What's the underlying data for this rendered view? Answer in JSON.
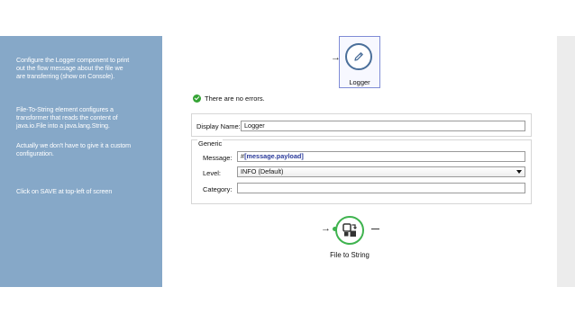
{
  "instructions": {
    "note_1": "Configure the Logger component to print\nout the flow message about the file we\nare transferring (show on Console).",
    "note_2": "File-To-String element configures a\ntransformer that reads the content of\njava.io.File into a java.lang.String.",
    "note_3": "Actually we don't have to give it a custom\nconfiguration.",
    "note_4": "Click on SAVE at top-left of screen"
  },
  "flow": {
    "arrow_glyph": "→",
    "logger_node": {
      "label": "Logger",
      "icon": "pencil-icon"
    },
    "file_to_string_node": {
      "label": "File to String",
      "icon": "transformer-icon"
    }
  },
  "properties": {
    "status_text": "There are no errors.",
    "display_name": {
      "label": "Display Name:",
      "value": "Logger"
    },
    "generic_group_title": "Generic",
    "message": {
      "label": "Message:",
      "value_hash": "#",
      "value_expression": "[message.payload]"
    },
    "level": {
      "label": "Level:",
      "selected": "INFO (Default)"
    },
    "category": {
      "label": "Category:",
      "value": ""
    }
  },
  "colors": {
    "panel_background": "#86a8c8",
    "logger_border": "#7f8cd6",
    "logger_icon": "#4a6f9a",
    "transformer_green": "#3fb34f",
    "status_ok": "#34a334"
  }
}
